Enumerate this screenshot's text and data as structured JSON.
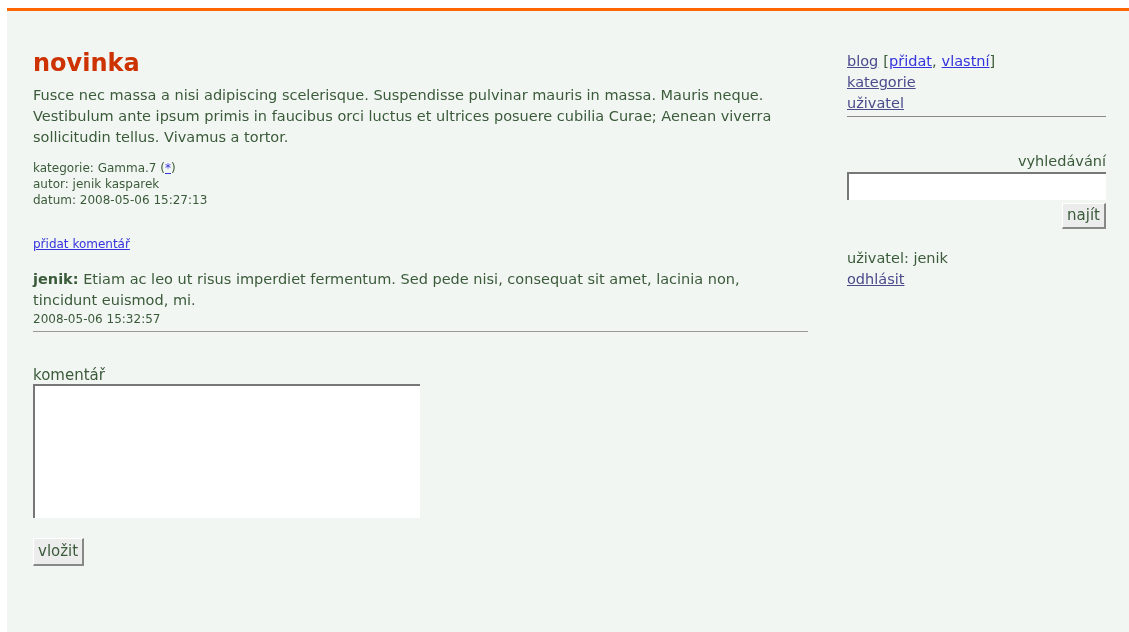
{
  "post": {
    "title": "novinka",
    "body": "Fusce nec massa a nisi adipiscing scelerisque. Suspendisse pulvinar mauris in massa. Mauris neque. Vestibulum ante ipsum primis in faucibus orci luctus et ultrices posuere cubilia Curae; Aenean viverra sollicitudin tellus. Vivamus a tortor.",
    "category_label": "kategorie: Gamma.7 (",
    "category_link": {
      "label": "*",
      "visited": false
    },
    "category_close": ")",
    "author": "autor: jenik kasparek",
    "date": "datum: 2008-05-06 15:27:13",
    "add_comment_link": {
      "label": "přidat komentář",
      "visited": false
    }
  },
  "comments": [
    {
      "author": "jenik:",
      "text": "Etiam ac leo ut risus imperdiet fermentum. Sed pede nisi, consequat sit amet, lacinia non, tincidunt euismod, mi.",
      "date": "2008-05-06 15:32:57"
    }
  ],
  "comment_form": {
    "label": "komentář",
    "button": "vložit"
  },
  "sidebar": {
    "nav": [
      {
        "label": "blog",
        "visited": true,
        "open": "[",
        "sep": ",",
        "close": "]",
        "sub": [
          {
            "label": "přidat",
            "visited": false
          },
          {
            "label": "vlastní",
            "visited": false
          }
        ]
      },
      {
        "label": "kategorie",
        "visited": true
      },
      {
        "label": "uživatel",
        "visited": true
      }
    ],
    "search": {
      "label": "vyhledávání",
      "button": "najít"
    },
    "user": "uživatel: jenik",
    "logout": {
      "label": "odhlásit",
      "visited": true
    }
  }
}
